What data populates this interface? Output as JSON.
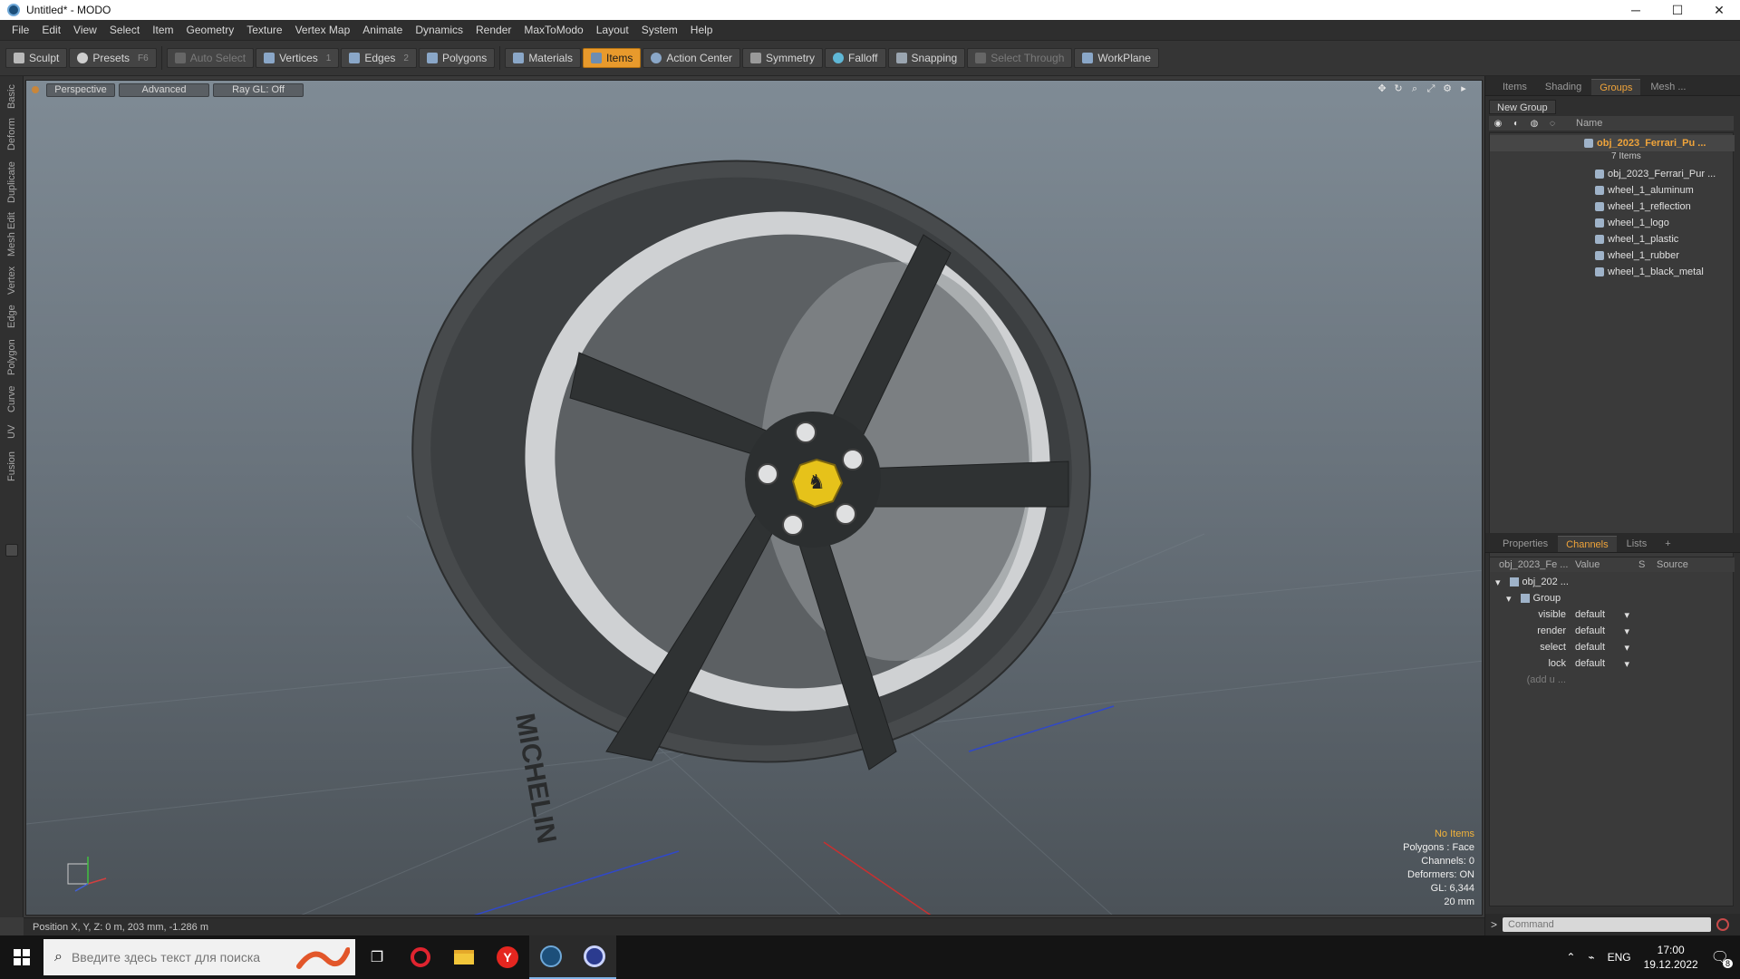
{
  "window": {
    "title": "Untitled* - MODO",
    "min": "─",
    "max": "☐",
    "close": "✕"
  },
  "menu": [
    "File",
    "Edit",
    "View",
    "Select",
    "Item",
    "Geometry",
    "Texture",
    "Vertex Map",
    "Animate",
    "Dynamics",
    "Render",
    "MaxToModo",
    "Layout",
    "System",
    "Help"
  ],
  "toolbar": {
    "sculpt": "Sculpt",
    "presets": "Presets",
    "presets_key": "F6",
    "auto_select": "Auto Select",
    "vertices": "Vertices",
    "vertices_key": "1",
    "edges": "Edges",
    "edges_key": "2",
    "polygons": "Polygons",
    "materials": "Materials",
    "items": "Items",
    "action_center": "Action Center",
    "symmetry": "Symmetry",
    "falloff": "Falloff",
    "snapping": "Snapping",
    "select_through": "Select Through",
    "workplane": "WorkPlane"
  },
  "left_tabs": [
    "Basic",
    "Deform",
    "Duplicate",
    "Mesh Edit",
    "Vertex",
    "Edge",
    "Polygon",
    "Curve",
    "UV",
    "Fusion"
  ],
  "viewport": {
    "perspective": "Perspective",
    "advanced": "Advanced",
    "raygl": "Ray GL: Off",
    "stats": {
      "no_items": "No Items",
      "polygons": "Polygons : Face",
      "channels": "Channels: 0",
      "deformers": "Deformers: ON",
      "gl": "GL: 6,344",
      "scale": "20 mm"
    },
    "tire_text": "MICHELIN"
  },
  "status": {
    "position": "Position X, Y, Z:  0 m, 203 mm, -1.286 m"
  },
  "groups_panel": {
    "tabs": [
      "Items",
      "Shading",
      "Groups",
      "Mesh ..."
    ],
    "active_tab": "Groups",
    "new_group": "New Group",
    "name_col": "Name",
    "group_name": "obj_2023_Ferrari_Pu ...",
    "group_count": "7 Items",
    "children": [
      "obj_2023_Ferrari_Pur ...",
      "wheel_1_aluminum",
      "wheel_1_reflection",
      "wheel_1_logo",
      "wheel_1_plastic",
      "wheel_1_rubber",
      "wheel_1_black_metal"
    ]
  },
  "channels_panel": {
    "tabs": [
      "Properties",
      "Channels",
      "Lists",
      "+"
    ],
    "active_tab": "Channels",
    "col_name": "obj_2023_Fe ...",
    "col_value": "Value",
    "col_s": "S",
    "col_source": "Source",
    "root": "obj_202 ...",
    "group": "Group",
    "rows": [
      {
        "name": "visible",
        "value": "default"
      },
      {
        "name": "render",
        "value": "default"
      },
      {
        "name": "select",
        "value": "default"
      },
      {
        "name": "lock",
        "value": "default"
      }
    ],
    "add_user": "(add u ..."
  },
  "command": {
    "placeholder": "Command",
    "prompt": ">"
  },
  "taskbar": {
    "search_placeholder": "Введите здесь текст для поиска",
    "lang": "ENG",
    "time": "17:00",
    "date": "19.12.2022",
    "notif_count": "8"
  }
}
